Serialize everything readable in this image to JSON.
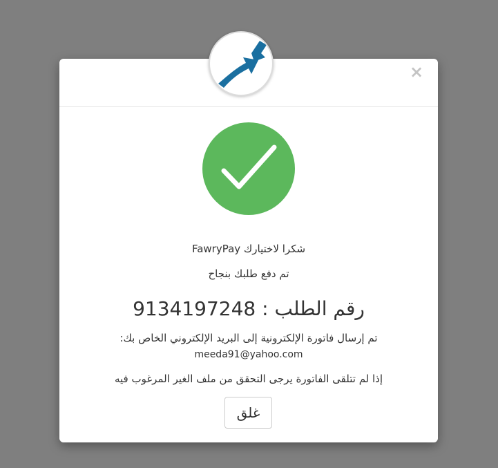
{
  "modal": {
    "close_symbol": "×",
    "logo_icon": "fawrypay-arrow-logo",
    "success_icon": "checkmark-icon",
    "thanks_text": "شكرا لاختيارك FawryPay",
    "paid_text": "تم دفع طلبك بنجاح",
    "order_line": "رقم الطلب : 9134197248",
    "invoice_sent_text": "تم إرسال فاتورة الإلكترونية إلى البريد الإلكتروني الخاص بك:",
    "email": "meeda91@yahoo.com",
    "spam_note": "إذا لم تتلقى الفاتورة يرجى التحقق من ملف الغير المرغوب فيه",
    "close_button_label": "غلق"
  },
  "colors": {
    "backdrop": "#7f7f7f",
    "success_green": "#5cb85c",
    "logo_blue": "#1a6fa0"
  }
}
